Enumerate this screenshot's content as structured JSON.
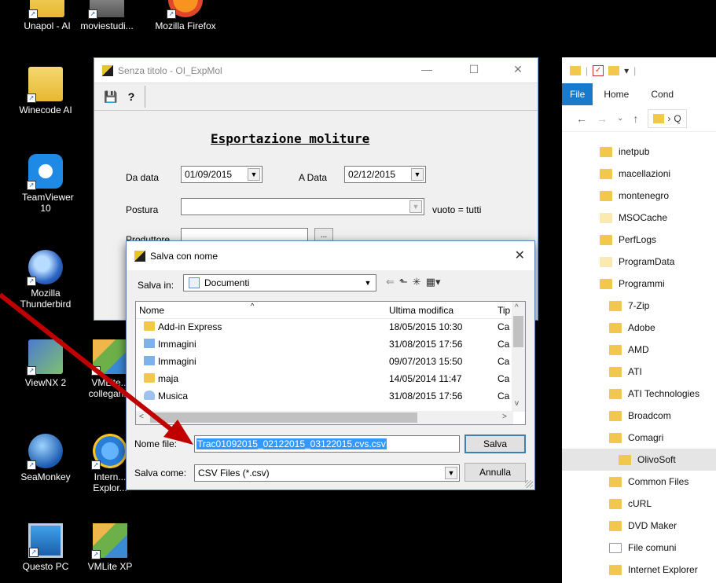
{
  "desktop": {
    "icons": [
      {
        "label": "Unapol - AI"
      },
      {
        "label": "moviestudi..."
      },
      {
        "label": "Mozilla Firefox"
      },
      {
        "label": "Winecode AI"
      },
      {
        "label": "TeamViewer 10"
      },
      {
        "label": "Mozilla Thunderbird"
      },
      {
        "label": "ViewNX 2"
      },
      {
        "label": "VMLite... collegan..."
      },
      {
        "label": "SeaMonkey"
      },
      {
        "label": "Intern... Explor..."
      },
      {
        "label": "Questo PC"
      },
      {
        "label": "VMLite XP"
      }
    ]
  },
  "main_window": {
    "title": "Senza titolo - OI_ExpMol",
    "form_title": "Esportazione moliture",
    "da_data_label": "Da data",
    "da_data_value": "01/09/2015",
    "a_data_label": "A Data",
    "a_data_value": "02/12/2015",
    "postura_label": "Postura",
    "postura_value": "",
    "postura_hint": "vuoto = tutti",
    "produttore_label": "Produttore",
    "browse_label": "..."
  },
  "save_dialog": {
    "title": "Salva con nome",
    "save_in_label": "Salva in:",
    "save_in_value": "Documenti",
    "columns": {
      "name": "Nome",
      "modified": "Ultima modifica",
      "type": "Tip"
    },
    "files": [
      {
        "name": "Add-in Express",
        "modified": "18/05/2015 10:30",
        "type": "Ca",
        "icon": "folder-icon"
      },
      {
        "name": "Immagini",
        "modified": "31/08/2015 17:56",
        "type": "Ca",
        "icon": "pictures-icon"
      },
      {
        "name": "Immagini",
        "modified": "09/07/2013 15:50",
        "type": "Ca",
        "icon": "pictures-icon"
      },
      {
        "name": "maja",
        "modified": "14/05/2014 11:47",
        "type": "Ca",
        "icon": "folder-icon"
      },
      {
        "name": "Musica",
        "modified": "31/08/2015 17:56",
        "type": "Ca",
        "icon": "music-icon"
      }
    ],
    "filename_label": "Nome file:",
    "filename_value": "Trac01092015_02122015_03122015.cvs.csv",
    "filetype_label": "Salva come:",
    "filetype_value": "CSV Files (*.csv)",
    "save_button": "Salva",
    "cancel_button": "Annulla"
  },
  "explorer": {
    "tabs": [
      "File",
      "Home",
      "Cond"
    ],
    "address": "Q",
    "tree": [
      {
        "label": "inetpub",
        "level": 0,
        "style": "normal"
      },
      {
        "label": "macellazioni",
        "level": 0,
        "style": "normal"
      },
      {
        "label": "montenegro",
        "level": 0,
        "style": "normal"
      },
      {
        "label": "MSOCache",
        "level": 0,
        "style": "pale"
      },
      {
        "label": "PerfLogs",
        "level": 0,
        "style": "normal"
      },
      {
        "label": "ProgramData",
        "level": 0,
        "style": "pale"
      },
      {
        "label": "Programmi",
        "level": 0,
        "style": "normal"
      },
      {
        "label": "7-Zip",
        "level": 1,
        "style": "normal"
      },
      {
        "label": "Adobe",
        "level": 1,
        "style": "normal"
      },
      {
        "label": "AMD",
        "level": 1,
        "style": "normal"
      },
      {
        "label": "ATI",
        "level": 1,
        "style": "normal"
      },
      {
        "label": "ATI Technologies",
        "level": 1,
        "style": "normal"
      },
      {
        "label": "Broadcom",
        "level": 1,
        "style": "normal"
      },
      {
        "label": "Comagri",
        "level": 1,
        "style": "normal"
      },
      {
        "label": "OlivoSoft",
        "level": 2,
        "style": "selected"
      },
      {
        "label": "Common Files",
        "level": 1,
        "style": "normal"
      },
      {
        "label": "cURL",
        "level": 1,
        "style": "normal"
      },
      {
        "label": "DVD Maker",
        "level": 1,
        "style": "normal"
      },
      {
        "label": "File comuni",
        "level": 1,
        "style": "link"
      },
      {
        "label": "Internet Explorer",
        "level": 1,
        "style": "normal"
      }
    ]
  },
  "colors": {
    "desktop_bg": "#000000",
    "explorer_file_tab": "#1979ca",
    "selection": "#3399ff",
    "annotation_arrow": "#c00000"
  }
}
